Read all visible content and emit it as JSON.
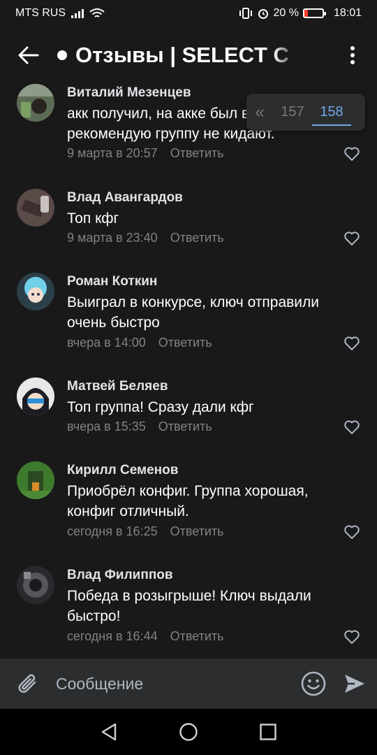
{
  "status_bar": {
    "carrier": "MTS RUS",
    "battery": "20 %",
    "battery_level": 0.2,
    "time": "18:01"
  },
  "header": {
    "title": "Отзывы | SELECT C",
    "icons": [
      "arrow-left-icon",
      "more-vertical-icon"
    ]
  },
  "pager": {
    "back_symbol": "«",
    "pages": [
      "157",
      "158"
    ],
    "current": "158"
  },
  "comments": [
    {
      "author": "Виталий Мезенцев",
      "text": "акк получил, на акке был всем рекомендую группу не кидают.",
      "time": "9 марта в 20:57",
      "reply": "Ответить"
    },
    {
      "author": "Влад Авангардов",
      "text": "Топ кфг",
      "time": "9 марта в 23:40",
      "reply": "Ответить"
    },
    {
      "author": "Роман Коткин",
      "text": "Выиграл в конкурсе, ключ отправили очень быстро",
      "time": "вчера в 14:00",
      "reply": "Ответить"
    },
    {
      "author": "Матвей Беляев",
      "text": "Топ группа! Сразу дали кфг",
      "time": "вчера в 15:35",
      "reply": "Ответить"
    },
    {
      "author": "Кирилл Семенов",
      "text": "Приобрёл конфиг. Группа хорошая, конфиг отличный.",
      "time": "сегодня в 16:25",
      "reply": "Ответить"
    },
    {
      "author": "Влад Филиппов",
      "text": "Победа в розыгрыше! Ключ выдали быстро!",
      "time": "сегодня в 16:44",
      "reply": "Ответить"
    }
  ],
  "compose": {
    "placeholder": "Сообщение",
    "icons": [
      "paperclip-icon",
      "smile-icon",
      "send-icon"
    ]
  },
  "navbar": {
    "icons": [
      "nav-back-icon",
      "nav-home-icon",
      "nav-recent-icon"
    ]
  },
  "colors": {
    "background": "#19191a",
    "panel": "#2c2d2e",
    "accent": "#71aaeb",
    "secondary_text": "#828282"
  }
}
